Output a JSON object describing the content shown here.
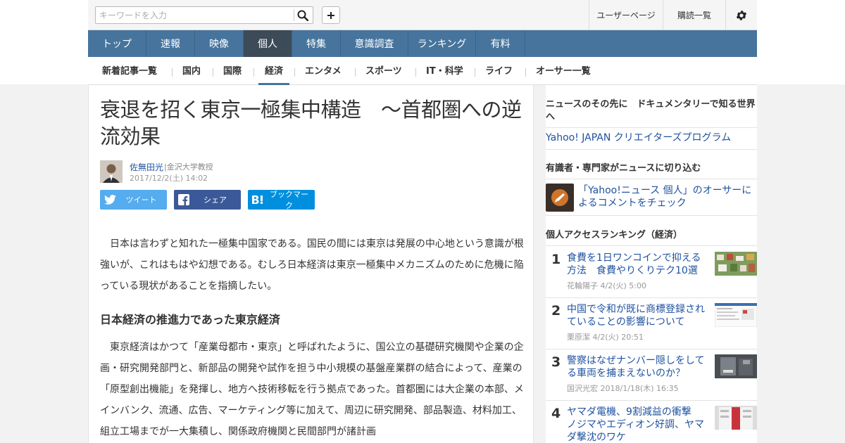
{
  "search": {
    "placeholder": "キーワードを入力"
  },
  "topbar": {
    "user_page": "ユーザーページ",
    "subscriptions": "購読一覧"
  },
  "mainnav": [
    {
      "label": "トップ"
    },
    {
      "label": "速報"
    },
    {
      "label": "映像"
    },
    {
      "label": "個人",
      "active": true
    },
    {
      "label": "特集"
    },
    {
      "label": "意識調査"
    },
    {
      "label": "ランキング"
    },
    {
      "label": "有料"
    }
  ],
  "subnav": [
    {
      "label": "新着記事一覧"
    },
    {
      "label": "国内"
    },
    {
      "label": "国際"
    },
    {
      "label": "経済",
      "active": true
    },
    {
      "label": "エンタメ"
    },
    {
      "label": "スポーツ"
    },
    {
      "label": "IT・科学"
    },
    {
      "label": "ライフ"
    },
    {
      "label": "オーサー一覧"
    }
  ],
  "article": {
    "headline": "衰退を招く東京一極集中構造　～首都圏への逆流効果",
    "author_name": "佐無田光",
    "author_role": "|金沢大学教授",
    "date": "2017/12/2(土) 14:02",
    "share": {
      "tweet": "ツイート",
      "facebook": "シェア",
      "hatena": "ブックマーク"
    },
    "paragraph1": "日本は言わずと知れた一極集中国家である。国民の間には東京は発展の中心地という意識が根強いが、これはもはや幻想である。むしろ日本経済は東京一極集中メカニズムのために危機に陥っている現状があることを指摘したい。",
    "heading1": "日本経済の推進力であった東京経済",
    "paragraph2": "東京経済はかつて「産業母都市・東京」と呼ばれたように、国公立の基礎研究機関や企業の企画・研究開発部門と、新部品の開発や試作を担う中小規模の基盤産業群の結合によって、産業の「原型創出機能」を発揮し、地方へ技術移転を行う拠点であった。首都圏には大企業の本部、メインバンク、流通、広告、マーケティング等に加えて、周辺に研究開発、部品製造、材料加工、組立工場までが一大集積し、関係政府機関と民間部門が諸計画"
  },
  "sidebar": {
    "promo_heading": "ニュースのその先に　ドキュメンタリーで知る世界へ",
    "promo_link": "Yahoo! JAPAN クリエイターズプログラム",
    "expert_heading": "有識者・専門家がニュースに切り込む",
    "expert_link": "「Yahoo!ニュース 個人」のオーサーによるコメントをチェック",
    "ranking_heading": "個人アクセスランキング（経済）",
    "ranking": [
      {
        "num": "1",
        "title": "食費を1日ワンコインで抑える方法　食費やりくりテク10選",
        "meta": "花輪陽子  4/2(火) 5:00"
      },
      {
        "num": "2",
        "title": "中国で令和が既に商標登録されていることの影響について",
        "meta": "栗原潔  4/2(火) 20:51"
      },
      {
        "num": "3",
        "title": "警察はなぜナンバー隠しをしてる車両を捕まえないのか？",
        "meta": "国沢光宏  2018/1/18(木) 16:35"
      },
      {
        "num": "4",
        "title": "ヤマダ電機、9割減益の衝撃　ノジマやエディオン好調、ヤマダ撃沈のワケ",
        "meta": ""
      }
    ]
  },
  "colors": {
    "nav_blue": "#46749d",
    "nav_active": "#3d4a57",
    "link_blue": "#1f52a0",
    "twitter": "#55acee",
    "facebook": "#3b5998",
    "hatena": "#008fde"
  },
  "icons": [
    "search-icon",
    "plus-icon",
    "gear-icon",
    "twitter-icon",
    "facebook-icon",
    "hatena-icon",
    "comment-icon"
  ]
}
